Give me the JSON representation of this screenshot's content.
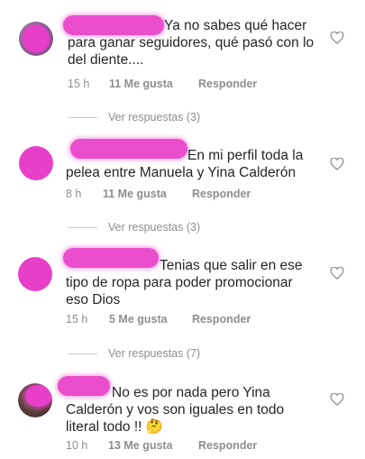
{
  "comments": [
    {
      "text_line1": "Ya no sabes qué hacer",
      "text_rest": "para ganar seguidores, qué pasó con lo del diente....",
      "time": "15 h",
      "likes": "11 Me gusta",
      "reply": "Responder"
    },
    {
      "text_line1": "En mi perfil toda la",
      "text_rest": "pelea entre Manuela y Yina Calderón",
      "time": "8 h",
      "likes": "11 Me gusta",
      "reply": "Responder"
    },
    {
      "text_line1": "Tenias que salir en ese",
      "text_rest": "tipo de ropa para poder promocionar eso Dios",
      "time": "15 h",
      "likes": "5 Me gusta",
      "reply": "Responder"
    },
    {
      "text_line1": "No es por nada pero Yina",
      "text_rest": "Calderón y vos son iguales en todo literal todo !! 🤔",
      "time": "10 h",
      "likes": "13 Me gusta",
      "reply": "Responder"
    }
  ],
  "view_replies": [
    "Ver respuestas (3)",
    "Ver respuestas (3)",
    "Ver respuestas (7)"
  ],
  "colors": {
    "redaction": "#e83fc9",
    "meta_text": "#8e8e8e",
    "divider": "#c7c7c7"
  },
  "icons": {
    "like": "heart-outline-icon"
  }
}
